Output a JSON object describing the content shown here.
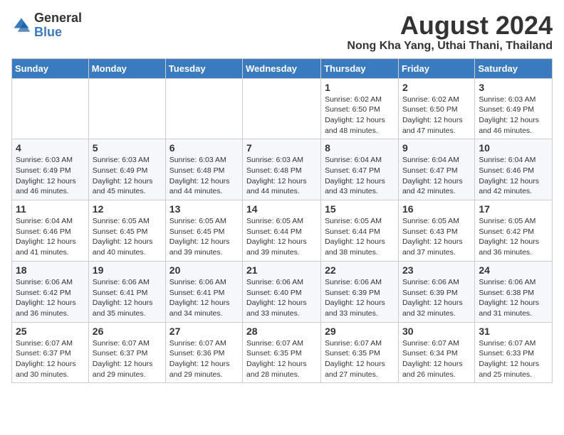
{
  "logo": {
    "general": "General",
    "blue": "Blue"
  },
  "title": "August 2024",
  "subtitle": "Nong Kha Yang, Uthai Thani, Thailand",
  "days": [
    "Sunday",
    "Monday",
    "Tuesday",
    "Wednesday",
    "Thursday",
    "Friday",
    "Saturday"
  ],
  "weeks": [
    [
      {
        "date": "",
        "info": ""
      },
      {
        "date": "",
        "info": ""
      },
      {
        "date": "",
        "info": ""
      },
      {
        "date": "",
        "info": ""
      },
      {
        "date": "1",
        "info": "Sunrise: 6:02 AM\nSunset: 6:50 PM\nDaylight: 12 hours\nand 48 minutes."
      },
      {
        "date": "2",
        "info": "Sunrise: 6:02 AM\nSunset: 6:50 PM\nDaylight: 12 hours\nand 47 minutes."
      },
      {
        "date": "3",
        "info": "Sunrise: 6:03 AM\nSunset: 6:49 PM\nDaylight: 12 hours\nand 46 minutes."
      }
    ],
    [
      {
        "date": "4",
        "info": "Sunrise: 6:03 AM\nSunset: 6:49 PM\nDaylight: 12 hours\nand 46 minutes."
      },
      {
        "date": "5",
        "info": "Sunrise: 6:03 AM\nSunset: 6:49 PM\nDaylight: 12 hours\nand 45 minutes."
      },
      {
        "date": "6",
        "info": "Sunrise: 6:03 AM\nSunset: 6:48 PM\nDaylight: 12 hours\nand 44 minutes."
      },
      {
        "date": "7",
        "info": "Sunrise: 6:03 AM\nSunset: 6:48 PM\nDaylight: 12 hours\nand 44 minutes."
      },
      {
        "date": "8",
        "info": "Sunrise: 6:04 AM\nSunset: 6:47 PM\nDaylight: 12 hours\nand 43 minutes."
      },
      {
        "date": "9",
        "info": "Sunrise: 6:04 AM\nSunset: 6:47 PM\nDaylight: 12 hours\nand 42 minutes."
      },
      {
        "date": "10",
        "info": "Sunrise: 6:04 AM\nSunset: 6:46 PM\nDaylight: 12 hours\nand 42 minutes."
      }
    ],
    [
      {
        "date": "11",
        "info": "Sunrise: 6:04 AM\nSunset: 6:46 PM\nDaylight: 12 hours\nand 41 minutes."
      },
      {
        "date": "12",
        "info": "Sunrise: 6:05 AM\nSunset: 6:45 PM\nDaylight: 12 hours\nand 40 minutes."
      },
      {
        "date": "13",
        "info": "Sunrise: 6:05 AM\nSunset: 6:45 PM\nDaylight: 12 hours\nand 39 minutes."
      },
      {
        "date": "14",
        "info": "Sunrise: 6:05 AM\nSunset: 6:44 PM\nDaylight: 12 hours\nand 39 minutes."
      },
      {
        "date": "15",
        "info": "Sunrise: 6:05 AM\nSunset: 6:44 PM\nDaylight: 12 hours\nand 38 minutes."
      },
      {
        "date": "16",
        "info": "Sunrise: 6:05 AM\nSunset: 6:43 PM\nDaylight: 12 hours\nand 37 minutes."
      },
      {
        "date": "17",
        "info": "Sunrise: 6:05 AM\nSunset: 6:42 PM\nDaylight: 12 hours\nand 36 minutes."
      }
    ],
    [
      {
        "date": "18",
        "info": "Sunrise: 6:06 AM\nSunset: 6:42 PM\nDaylight: 12 hours\nand 36 minutes."
      },
      {
        "date": "19",
        "info": "Sunrise: 6:06 AM\nSunset: 6:41 PM\nDaylight: 12 hours\nand 35 minutes."
      },
      {
        "date": "20",
        "info": "Sunrise: 6:06 AM\nSunset: 6:41 PM\nDaylight: 12 hours\nand 34 minutes."
      },
      {
        "date": "21",
        "info": "Sunrise: 6:06 AM\nSunset: 6:40 PM\nDaylight: 12 hours\nand 33 minutes."
      },
      {
        "date": "22",
        "info": "Sunrise: 6:06 AM\nSunset: 6:39 PM\nDaylight: 12 hours\nand 33 minutes."
      },
      {
        "date": "23",
        "info": "Sunrise: 6:06 AM\nSunset: 6:39 PM\nDaylight: 12 hours\nand 32 minutes."
      },
      {
        "date": "24",
        "info": "Sunrise: 6:06 AM\nSunset: 6:38 PM\nDaylight: 12 hours\nand 31 minutes."
      }
    ],
    [
      {
        "date": "25",
        "info": "Sunrise: 6:07 AM\nSunset: 6:37 PM\nDaylight: 12 hours\nand 30 minutes."
      },
      {
        "date": "26",
        "info": "Sunrise: 6:07 AM\nSunset: 6:37 PM\nDaylight: 12 hours\nand 29 minutes."
      },
      {
        "date": "27",
        "info": "Sunrise: 6:07 AM\nSunset: 6:36 PM\nDaylight: 12 hours\nand 29 minutes."
      },
      {
        "date": "28",
        "info": "Sunrise: 6:07 AM\nSunset: 6:35 PM\nDaylight: 12 hours\nand 28 minutes."
      },
      {
        "date": "29",
        "info": "Sunrise: 6:07 AM\nSunset: 6:35 PM\nDaylight: 12 hours\nand 27 minutes."
      },
      {
        "date": "30",
        "info": "Sunrise: 6:07 AM\nSunset: 6:34 PM\nDaylight: 12 hours\nand 26 minutes."
      },
      {
        "date": "31",
        "info": "Sunrise: 6:07 AM\nSunset: 6:33 PM\nDaylight: 12 hours\nand 25 minutes."
      }
    ]
  ]
}
